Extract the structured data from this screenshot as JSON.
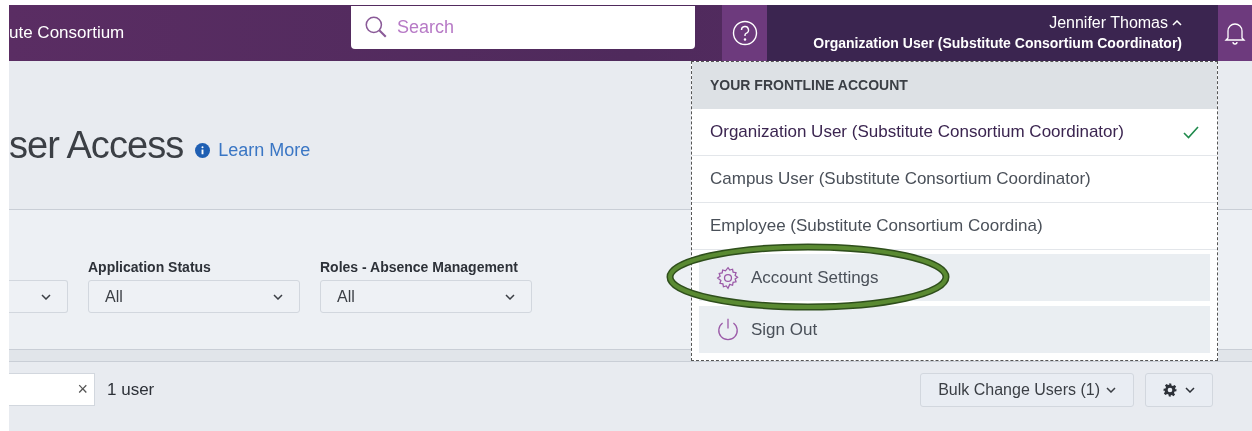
{
  "header": {
    "org_name": "ute Consortium",
    "search": {
      "placeholder": "Search"
    },
    "user": {
      "name": "Jennifer Thomas",
      "role": "Organization User (Substitute Consortium Coordinator)",
      "expanded": true
    }
  },
  "page": {
    "title": "ser Access",
    "learn_more": "Learn More"
  },
  "filters": [
    {
      "kind": "partial"
    },
    {
      "kind": "full",
      "label": "Application Status",
      "value": "All"
    },
    {
      "kind": "full",
      "label": "Roles - Absence Management",
      "value": "All"
    }
  ],
  "results": {
    "clear": "×",
    "count": "1 user",
    "bulk_button": "Bulk Change Users (1)"
  },
  "account_menu": {
    "heading": "YOUR FRONTLINE ACCOUNT",
    "accounts": [
      {
        "label": "Organization User (Substitute Consortium Coordinator)",
        "selected": true
      },
      {
        "label": "Campus User (Substitute Consortium Coordinator)",
        "selected": false
      },
      {
        "label": "Employee (Substitute Consortium Coordina)",
        "selected": false
      }
    ],
    "actions": [
      {
        "kind": "settings",
        "label": "Account Settings"
      },
      {
        "kind": "signout",
        "label": "Sign Out"
      }
    ]
  }
}
